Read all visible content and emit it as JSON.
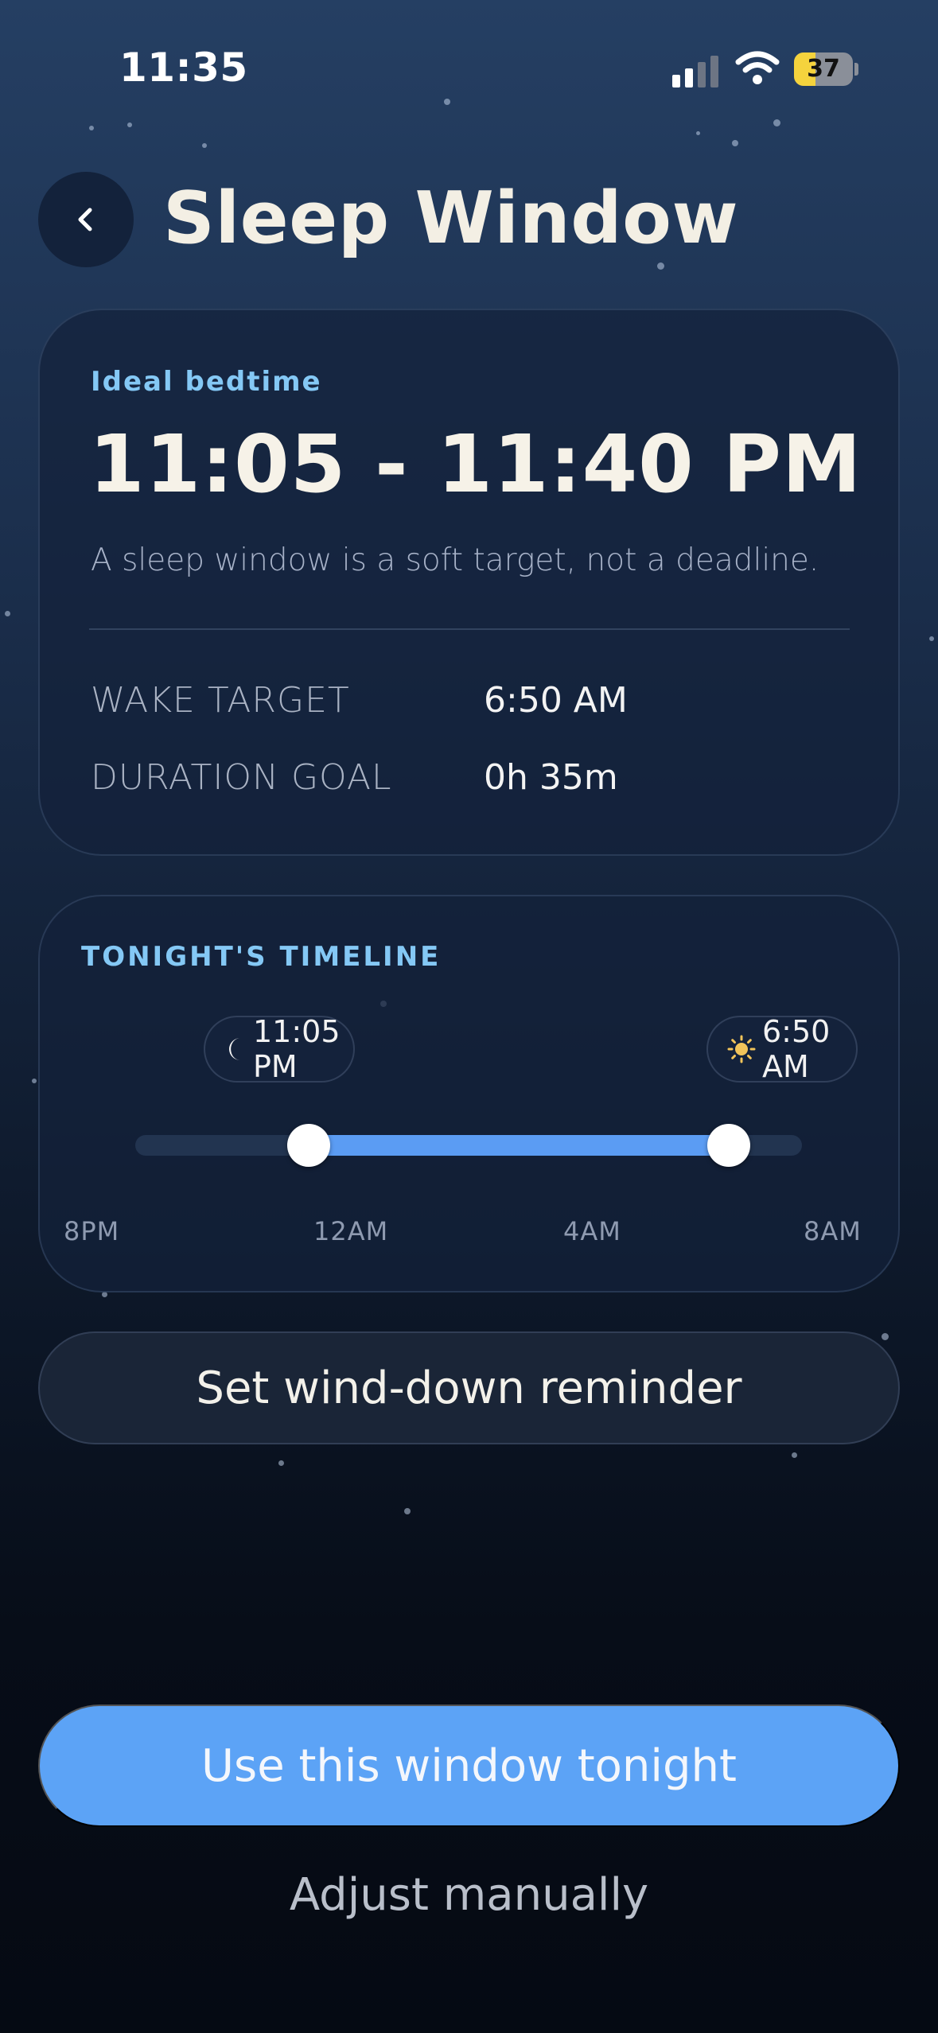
{
  "status_bar": {
    "time": "11:35",
    "battery": "37",
    "battery_level": 0.37
  },
  "header": {
    "title": "Sleep Window",
    "back_icon": "chevron-left-icon"
  },
  "bedtime_card": {
    "label": "Ideal bedtime",
    "range": "11:05 - 11:40 PM",
    "subtitle": "A sleep window is a soft target, not a deadline.",
    "rows": [
      {
        "label": "WAKE TARGET",
        "value": "6:50 AM"
      },
      {
        "label": "DURATION GOAL",
        "value": "0h 35m"
      }
    ]
  },
  "timeline_card": {
    "label": "TONIGHT'S TIMELINE",
    "start": {
      "time": "11:05 PM",
      "icon": "moon-icon",
      "fraction": 0.26
    },
    "end": {
      "time": "6:50 AM",
      "icon": "sun-icon",
      "fraction": 0.89
    },
    "ticks": [
      "8PM",
      "12AM",
      "4AM",
      "8AM"
    ]
  },
  "actions": {
    "reminder": "Set wind-down reminder",
    "primary": "Use this window tonight",
    "secondary": "Adjust manually"
  },
  "colors": {
    "accent": "#5ca3f6",
    "eyebrow": "#84c8f5",
    "battery": "#f5d33d",
    "sun": "#f2c45a"
  }
}
